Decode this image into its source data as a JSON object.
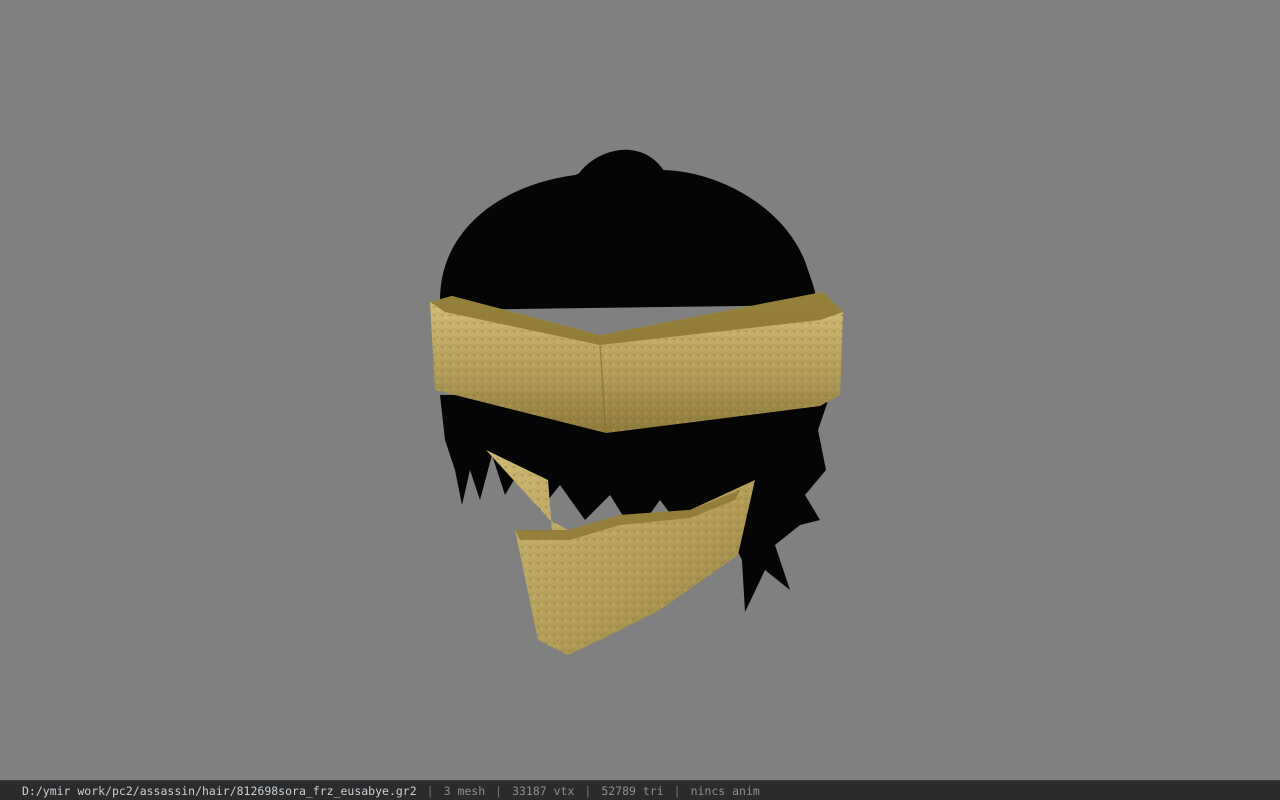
{
  "viewport": {
    "model_icon": "hair-with-gold-headband-and-mask-model"
  },
  "status": {
    "file_path": "D:/ymir work/pc2/assassin/hair/812698sora_frz_eusabye.gr2",
    "separator": "|",
    "mesh_count": "3 mesh",
    "vertex_count": "33187 vtx",
    "triangle_count": "52789 tri",
    "anim_status": "nincs anim"
  },
  "colors": {
    "background": "#808080",
    "hair": "#050505",
    "gold": "#b49a4f",
    "status_bar": "#2b2b2b"
  }
}
